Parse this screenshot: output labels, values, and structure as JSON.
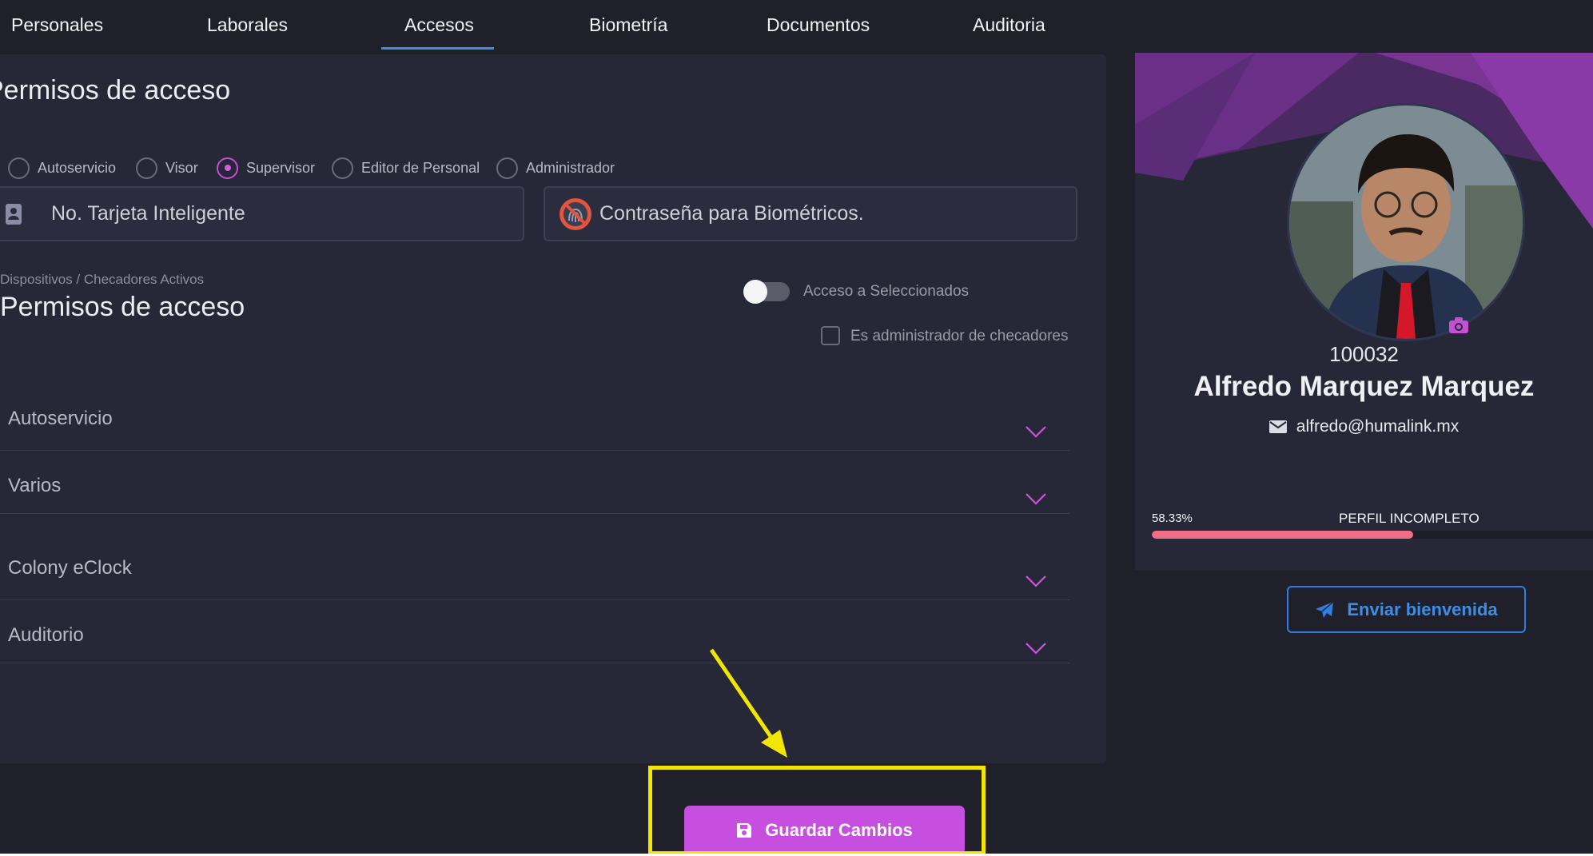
{
  "tabs": [
    "Personales",
    "Laborales",
    "Accesos",
    "Biometría",
    "Documentos",
    "Auditoria"
  ],
  "active_tab": "Accesos",
  "access": {
    "title": "Permisos de acceso",
    "roles": [
      "Autoservicio",
      "Visor",
      "Supervisor",
      "Editor de Personal",
      "Administrador"
    ],
    "selected_role": "Supervisor",
    "smart_card_placeholder": "No. Tarjeta Inteligente",
    "biometric_password_placeholder": "Contraseña para Biométricos."
  },
  "devices": {
    "caption": "Dispositivos / Checadores Activos",
    "title": "Permisos de acceso",
    "toggle_label": "Acceso a Seleccionados",
    "toggle_on": false,
    "checkbox_label": "Es administrador de checadores",
    "checkbox_checked": false,
    "groups": [
      "Autoservicio",
      "Varios",
      "Colony eClock",
      "Auditorio"
    ]
  },
  "profile": {
    "employee_id": "100032",
    "name": "Alfredo Marquez Marquez",
    "email": "alfredo@humalink.mx",
    "completion_label": "58.33%",
    "completion_fraction": 0.5833,
    "status": "PERFIL INCOMPLETO",
    "welcome_button": "Enviar bienvenida"
  },
  "save_button": "Guardar Cambios",
  "colors": {
    "accent_purple": "#c74fe0",
    "accent_blue": "#3d8ee8",
    "progress": "#ef6f86",
    "highlight": "#f2e600"
  },
  "icons": [
    "id-card-icon",
    "fingerprint-blocked-icon",
    "chevron-down-icon",
    "camera-icon",
    "envelope-icon",
    "paper-plane-icon",
    "floppy-disk-icon",
    "annotation-arrow"
  ]
}
